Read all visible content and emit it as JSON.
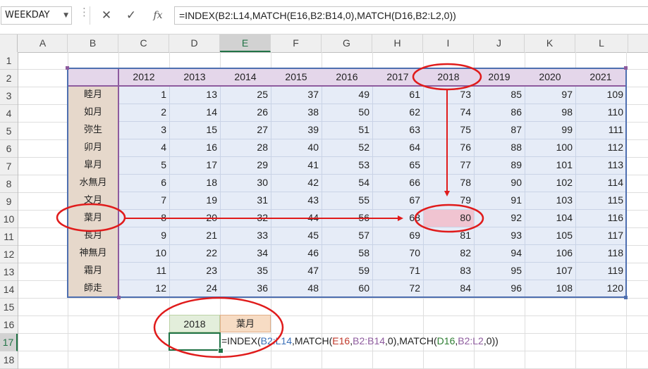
{
  "formula_bar": {
    "name_box": "WEEKDAY",
    "name_box_arrow": "▼",
    "dots": "⋮",
    "cancel_icon": "✕",
    "enter_icon": "✓",
    "fx_icon": "fx",
    "formula": "=INDEX(B2:L14,MATCH(E16,B2:B14,0),MATCH(D16,B2:L2,0))"
  },
  "columns": [
    "A",
    "B",
    "C",
    "D",
    "E",
    "F",
    "G",
    "H",
    "I",
    "J",
    "K",
    "L"
  ],
  "selected_column": "E",
  "rows": [
    "1",
    "2",
    "3",
    "4",
    "5",
    "6",
    "7",
    "8",
    "9",
    "10",
    "11",
    "12",
    "13",
    "14",
    "15",
    "16",
    "17",
    "18"
  ],
  "selected_row": "17",
  "table": {
    "years": [
      "2012",
      "2013",
      "2014",
      "2015",
      "2016",
      "2017",
      "2018",
      "2019",
      "2020",
      "2021"
    ],
    "months": [
      "睦月",
      "如月",
      "弥生",
      "卯月",
      "皐月",
      "水無月",
      "文月",
      "葉月",
      "長月",
      "神無月",
      "霜月",
      "師走"
    ],
    "values": [
      [
        "1",
        "13",
        "25",
        "37",
        "49",
        "61",
        "73",
        "85",
        "97",
        "109"
      ],
      [
        "2",
        "14",
        "26",
        "38",
        "50",
        "62",
        "74",
        "86",
        "98",
        "110"
      ],
      [
        "3",
        "15",
        "27",
        "39",
        "51",
        "63",
        "75",
        "87",
        "99",
        "111"
      ],
      [
        "4",
        "16",
        "28",
        "40",
        "52",
        "64",
        "76",
        "88",
        "100",
        "112"
      ],
      [
        "5",
        "17",
        "29",
        "41",
        "53",
        "65",
        "77",
        "89",
        "101",
        "113"
      ],
      [
        "6",
        "18",
        "30",
        "42",
        "54",
        "66",
        "78",
        "90",
        "102",
        "114"
      ],
      [
        "7",
        "19",
        "31",
        "43",
        "55",
        "67",
        "79",
        "91",
        "103",
        "115"
      ],
      [
        "8",
        "20",
        "32",
        "44",
        "56",
        "68",
        "80",
        "92",
        "104",
        "116"
      ],
      [
        "9",
        "21",
        "33",
        "45",
        "57",
        "69",
        "81",
        "93",
        "105",
        "117"
      ],
      [
        "10",
        "22",
        "34",
        "46",
        "58",
        "70",
        "82",
        "94",
        "106",
        "118"
      ],
      [
        "11",
        "23",
        "35",
        "47",
        "59",
        "71",
        "83",
        "95",
        "107",
        "119"
      ],
      [
        "12",
        "24",
        "36",
        "48",
        "60",
        "72",
        "84",
        "96",
        "108",
        "120"
      ]
    ]
  },
  "lookup": {
    "year": "2018",
    "month": "葉月",
    "formula_parts": [
      "=INDEX(",
      "B2:L14",
      ",MATCH(",
      "E16",
      ",",
      "B2:B14",
      ",0),MATCH(",
      "D16",
      ",",
      "B2:L2",
      ",0))"
    ]
  },
  "colors": {
    "annotation_red": "#e01b1b",
    "header_band": "#e4d6ea",
    "month_band": "#e6d8cb",
    "body_band": "#e6ecf7",
    "highlight_cell": "#f0c4d1",
    "active_cell_border": "#217346"
  }
}
